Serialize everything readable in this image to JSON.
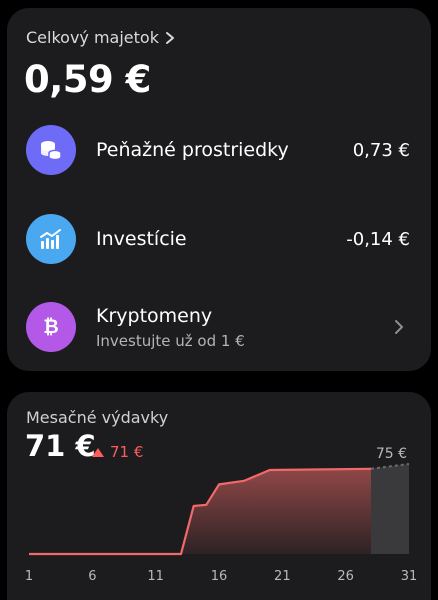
{
  "assets": {
    "header": "Celkový majetok",
    "total": "0,59 €",
    "rows": [
      {
        "label": "Peňažné prostriedky",
        "value": "0,73 €",
        "icon": "coins-icon",
        "color": "#6e6cf7"
      },
      {
        "label": "Investície",
        "value": "-0,14 €",
        "icon": "investment-chart-icon",
        "color": "#4aa8f0"
      },
      {
        "label": "Kryptomeny",
        "sub": "Investujte už od 1 €",
        "icon": "bitcoin-icon",
        "color": "#b458e8"
      }
    ]
  },
  "spending": {
    "title": "Mesačné výdavky",
    "amount": "71 €",
    "delta": "71 €",
    "delta_color": "#ff5c5c"
  },
  "chart_data": {
    "type": "area",
    "x_ticks": [
      "1",
      "6",
      "11",
      "16",
      "21",
      "26",
      "31"
    ],
    "forecast_label": "75 €",
    "series": [
      {
        "points": [
          [
            1,
            0
          ],
          [
            13,
            0
          ],
          [
            14,
            40
          ],
          [
            15,
            41
          ],
          [
            16,
            58
          ],
          [
            18,
            61
          ],
          [
            20,
            70
          ],
          [
            28,
            71
          ]
        ]
      }
    ],
    "forecast": [
      [
        28,
        71
      ],
      [
        31,
        75
      ]
    ],
    "xlim": [
      1,
      31
    ],
    "ylim": [
      0,
      75
    ],
    "line_color": "#f06a6a",
    "forecast_color": "#3a3a3d"
  }
}
